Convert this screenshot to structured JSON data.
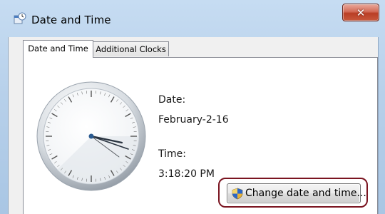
{
  "window": {
    "title": "Date and Time",
    "title_icon": "date-time-icon",
    "close_icon": "close-icon"
  },
  "tabs": [
    {
      "label": "Date and Time",
      "active": true
    },
    {
      "label": "Additional Clocks",
      "active": false
    }
  ],
  "date_section": {
    "date_label": "Date:",
    "date_value": "February-2-16",
    "time_label": "Time:",
    "time_value": "3:18:20 PM"
  },
  "clock": {
    "icon": "analog-clock-icon",
    "hour": 3,
    "minute": 18,
    "second": 20
  },
  "buttons": {
    "change_date_time_label": "Change date and time...",
    "change_date_time_icon": "uac-shield-icon"
  },
  "colors": {
    "highlight_ring": "#7a1420",
    "close_button": "#c8503a"
  }
}
